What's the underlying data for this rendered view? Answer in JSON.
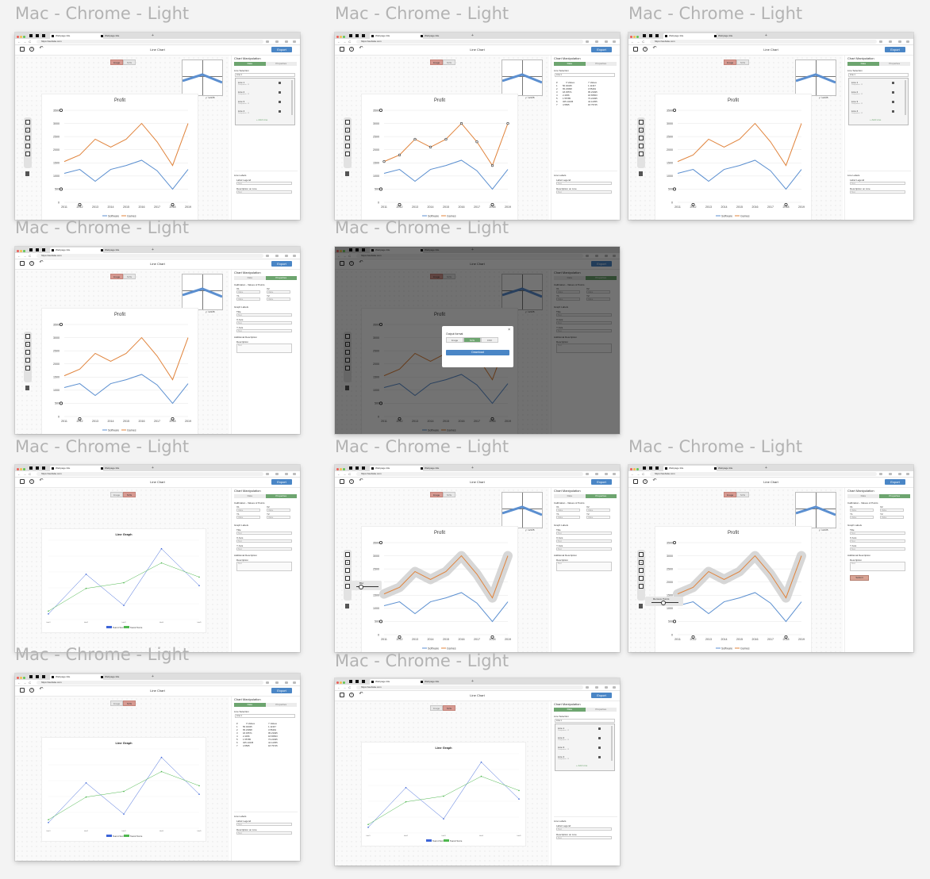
{
  "frame_label": "Mac - Chrome - Light",
  "browser": {
    "tab_title": "Webpage title",
    "url": "https://website.com",
    "new_tab": "+",
    "nav": "← → C"
  },
  "app": {
    "title": "Line Chart",
    "export": "Export",
    "toggle_image": "Image",
    "toggle_svg": "SVG",
    "coord_x": "x: 13425",
    "coord_y": "y: 12135"
  },
  "panel": {
    "title": "Chart Manipulation",
    "tab_data": "Data",
    "tab_properties": "Properties",
    "line_selection": "Line Selection",
    "selected_line": "Line 1",
    "lines": [
      "Line 1",
      "Line 2",
      "Line 3",
      "Line 4"
    ],
    "line_sub": "Datapoints: 12",
    "add_line": "+ Add Line",
    "line_labels": "Line Labels",
    "label_legend": "Label Legend",
    "description_on_line": "Description on Line",
    "text_placeholder": "Text",
    "calibration": "Calibration - Values of Points",
    "x1": "X1",
    "x2": "X2",
    "y1": "Y1",
    "y2": "Y2",
    "value_placeholder": "Value",
    "graph_labels": "Graph Labels",
    "title_label": "Title",
    "x_axis": "X Axis",
    "y_axis": "Y Axis",
    "additional_description": "Additional Description",
    "description_label": "Description",
    "submit": "Submit",
    "table_header": [
      "#",
      "X Values",
      "Y Values"
    ],
    "table_rows": [
      [
        "1",
        "56.02345",
        "1.11347"
      ],
      [
        "2",
        "65.23098",
        "3.55491"
      ],
      [
        "3",
        "18.45571",
        "95.23495"
      ],
      [
        "4",
        "2.4456",
        "18.65563"
      ],
      [
        "5",
        "1.55785",
        "73.24495"
      ],
      [
        "6",
        "325.13445",
        "44.12355"
      ],
      [
        "7",
        "4.5565",
        "18.75745"
      ]
    ]
  },
  "modal": {
    "title": "Output format",
    "formats": [
      "Image",
      "SVG",
      "CSV"
    ],
    "download": "Download"
  },
  "tools": {
    "blur": "Blur",
    "remove_points": "Remove Points"
  },
  "chart_data": [
    {
      "type": "line",
      "title": "Profit",
      "categories": [
        "2011",
        "2012",
        "2013",
        "2014",
        "2015",
        "2016",
        "2017",
        "2018",
        "2019"
      ],
      "series": [
        {
          "name": "Software",
          "values": [
            1100,
            1250,
            800,
            1250,
            1400,
            1600,
            1200,
            500,
            1250
          ]
        },
        {
          "name": "Games",
          "values": [
            1550,
            1800,
            2400,
            2100,
            2400,
            3000,
            2300,
            1400,
            3000
          ]
        }
      ],
      "ylim": [
        0,
        3500
      ],
      "yticks": [
        0,
        500,
        1000,
        1500,
        2000,
        2500,
        3000,
        3500
      ],
      "grid": true,
      "legend": "bottom"
    },
    {
      "type": "line",
      "title": "Line Graph",
      "categories": [
        "label1",
        "label2",
        "label3",
        "label4",
        "label5"
      ],
      "series": [
        {
          "name": "Team1 Score",
          "values": [
            100,
            240,
            130,
            330,
            200
          ]
        },
        {
          "name": "Team2 Score",
          "values": [
            110,
            190,
            210,
            280,
            230
          ]
        }
      ],
      "ylim": [
        80,
        360
      ],
      "grid": true,
      "legend": "bottom"
    }
  ]
}
